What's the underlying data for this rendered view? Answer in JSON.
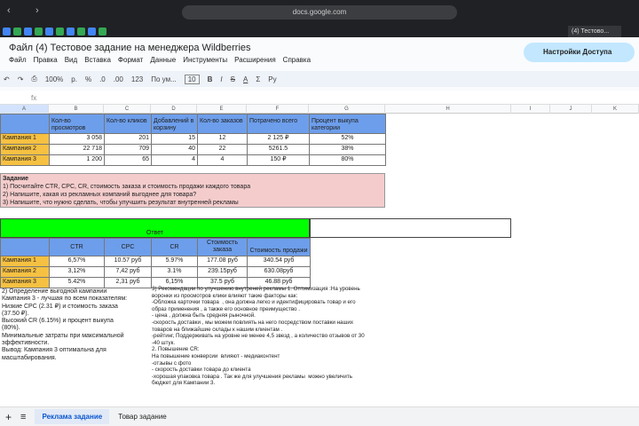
{
  "browser": {
    "url": "docs.google.com",
    "active_tab": "(4) Тестово..."
  },
  "doc": {
    "title": "Файл (4) Тестовое задание на менеджера Wildberries",
    "share": "Настройки Доступа",
    "menu": [
      "Файл",
      "Правка",
      "Вид",
      "Вставка",
      "Формат",
      "Данные",
      "Инструменты",
      "Расширения",
      "Справка"
    ],
    "toolbar": {
      "zoom": "100%",
      "currency": "р.",
      "percent": "%",
      "dec_less": ".0",
      "dec_more": ".00",
      "format": "123",
      "font": "По ум...",
      "font_size": "10",
      "bold": "B",
      "italic": "I",
      "strike": "S",
      "text_color": "A",
      "functions": "Σ",
      "lang": "Ру"
    },
    "fx": "fx"
  },
  "columns": [
    "A",
    "B",
    "C",
    "D",
    "E",
    "F",
    "G",
    "H",
    "I",
    "J",
    "K"
  ],
  "table1": {
    "headers": [
      "",
      "Кол-во просмотров",
      "Кол-во кликов",
      "Добавлений в корзину",
      "Кол-во заказов",
      "Потрачено всего",
      "Процент выкупа категории"
    ],
    "rows": [
      [
        "Кампания 1",
        "3 058",
        "201",
        "15",
        "12",
        "2 125 ₽",
        "52%"
      ],
      [
        "Кампания 2",
        "22 718",
        "709",
        "40",
        "22",
        "5261.5",
        "38%"
      ],
      [
        "Кампания 3",
        "1 200",
        "65",
        "4",
        "4",
        "150 ₽",
        "80%"
      ]
    ]
  },
  "task": {
    "title": "Задание",
    "lines": [
      "1) Посчитайте CTR, CPC, CR, стоимость заказа и стоимость продажи каждого товара",
      "2) Напишите, какая из рекламных компаний выгоднее для товара?",
      "3) Напишите, что нужно сделать, чтобы улучшить результат внутренней рекламы"
    ]
  },
  "answer": {
    "title": "Ответ",
    "headers": [
      "",
      "CTR",
      "CPC",
      "CR",
      "Стоимость заказа",
      "Стоимость продажи"
    ],
    "rows": [
      [
        "Кампания 1",
        "6,57%",
        "10.57 руб",
        "5.97%",
        "177.08 руб",
        "340.54 руб"
      ],
      [
        "Кампания 2",
        "3,12%",
        "7,42 руб",
        "3.1%",
        "239.15руб",
        "630.08руб"
      ],
      [
        "Кампания 3",
        "5.42%",
        "2,31 руб",
        "6,15%",
        "37.5 руб",
        "46.88 руб"
      ]
    ]
  },
  "conclusion": "2) Определение выгодной кампании\nКампания 3 - лучшая по всем показателям:\nНизкие CPC (2.31 ₽) и стоимость заказа\n(37.50 ₽).\nВысокий CR (6.15%) и процент выкупа\n(80%).\nМинимальные затраты при максимальной\nэффективности.\nВывод: Кампания 3 оптимальна для\nмасштабирования.",
  "recommendations": "3) Рекомендации по улучшению внутреней рекламы 1. Оптимизация :На уровень\nворонки из просмотров клики влияют такие факторы как:\n-Обложка карточки товара  , она должна легко и идентифицировать товар и его\nобраз применения , а также его основное преимущество .\n- цена , должна быть средняя рыночной.\n-скорость доставки , мы можем повлиять на него посредством поставки наших\nтоваров на ближайшие склады к нашим клиентам .\n-рейтинг, Поддерживать на уровне не менее 4,5 звезд , а количество отзывов от 30\n-40 штук.\n2. Повышение CR:\nНа повышение конверсии  влияют - медиаконтент\n-отзывы с фото\n- скорость доставки товара до клиента\n-хорошая упаковка товара . Так же для улучшения рекламы  можно увеличить\nбюджет для Кампании 3.",
  "sheets": {
    "add": "+",
    "list": "≡",
    "tabs": [
      "Реклама задание",
      "Товар задание"
    ]
  }
}
